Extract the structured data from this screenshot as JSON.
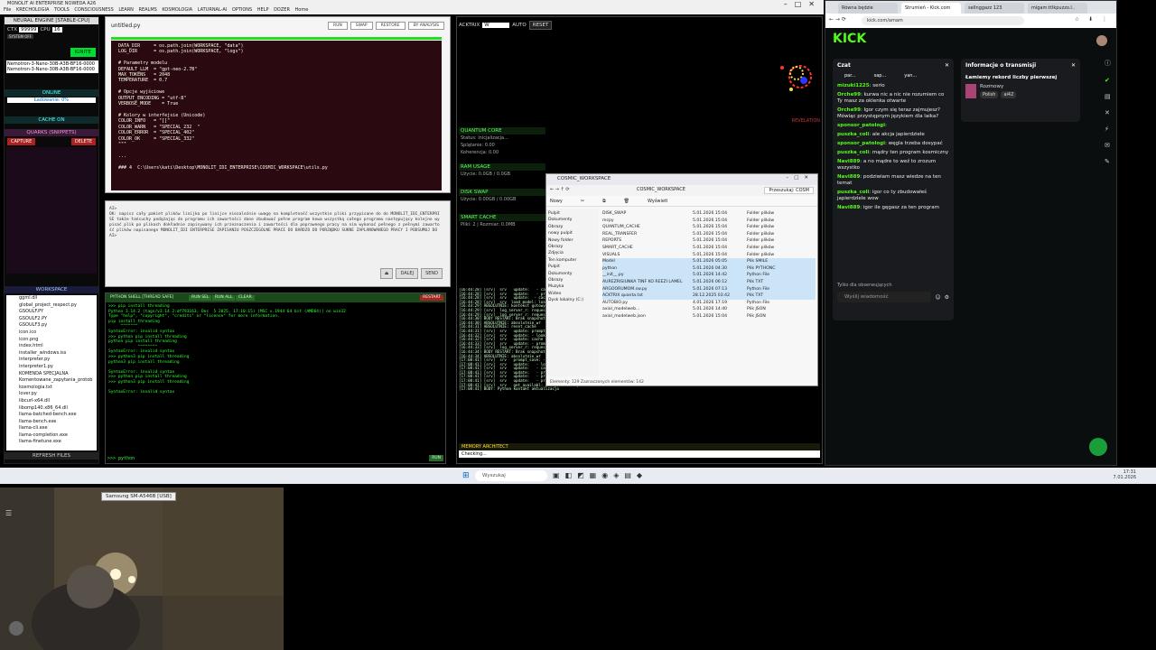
{
  "app": {
    "title": "NEURAL ENGINE [STABLE-CPU]",
    "menu": "File  KRECHOLOGIA  TOOLS  CONSCIOUSNESS  LEARN  REALMS  KOSMOLOGIA  LATURNAL-AI  OPTIONS  HELP  DOZER  Home",
    "window_title": "MONOLIT AI ENTERPRISE NOWEDA A26"
  },
  "left": {
    "ctx_label": "CTX",
    "ctx": "99999",
    "cpu_label": "CPU",
    "cpu": "16",
    "status_tag": "SYSTEM OFF",
    "ignite": "IGNITE",
    "models": [
      "Nemotron-3-Nano-30B-A3B-BF16-0000",
      "Nemotron-3-Nano-30B-A3B-BF16-0000"
    ],
    "online": "ONLINE",
    "loading": "Ładowanie: 0%",
    "cache": "CACHE ON",
    "quarks": "QUARKS (SNIPPETS)",
    "capture": "CAPTURE",
    "delete": "DELETE",
    "workspace": "WORKSPACE",
    "files": [
      "ggml.dll",
      "global_project_respect.py",
      "GSOULF.PY",
      "GSOULF2.PY",
      "GSOULF3.py",
      "icon.ico",
      "icon.png",
      "index.html",
      "installer_windows.iss",
      "interpreter.py",
      "interpreter1.py",
      "KOMENDA SPECJALNA",
      "Komentowane_zapytania_protob",
      "kosmologia.txt",
      "lover.py",
      "libcurl-x64.dll",
      "libomp140.x86_64.dll",
      "llama-batched-bench.exe",
      "llama-bench.exe",
      "llama-cli.exe",
      "llama-completion.exe",
      "llama-finetune.exe"
    ],
    "refresh": "REFRESH FILES"
  },
  "editor": {
    "filename": "untitled.py",
    "btns": [
      "RUN",
      "SWAP",
      "RESTORE",
      "BY ANALYSIS"
    ],
    "code": "DATA_DIR     = os.path.join(WORKSPACE, \"data\")\nLOG_DIR      = os.path.join(WORKSPACE, \"logs\")\n\n# Parametry modelu\nDEFAULT_LLM  = \"gpt-neo-2.7B\"\nMAX_TOKENS   = 2048\nTEMPERATURE  = 0.7\n\n# Opcje wyjściowe\nOUTPUT_ENCODING = \"utf-8\"\nVERBOSE_MODE    = True\n\n# Kolory w interfejsie (Unicode)\nCOLOR_INFO   = \"[]\"\nCOLOR_WARN   = \"SPECIAL_232  \"\nCOLOR_ERROR  = \"SPECIAL_402\"\nCOLOR_OK     = \"SPECIAL_332\"\n\"\"\"\n\n...\n\n### 4  C:\\Users\\kati\\Desktop\\MONOLIT_IDI_ENTERPRISE\\COSMIC_WORKSPACE\\utils.py"
  },
  "chatbox": {
    "text": "AI>\nOK: napisz cały pakiet plików linijka po linijce niezależnie uwagę na kompletność wszystkie pliki przypisane do do MONOLIT_IDI_ENTERPRISE także łańcuchy podążając do programu ich zawartości dane zbudować pełne program kowa wszystką całego programu następujący kolejno wypisać plik po plikach dokładnie zapisywany ich przeznaczenia i zawartości dla poprawnego pracy na nim wykonać pełnego z pełnymi zawartość plików napisanego MONOLIT_IDI ENTERPRISE ZAPISANIU POSZCZEGÓLNE PRACE DO BARDZO DO PORZĄDKU SUKNE ZAPLANOWANEGO PRACY I PODSUMUJ DO\nAI>",
    "stop": "DALEJ",
    "send": "SEND"
  },
  "shell": {
    "title": "PYTHON SHELL [THREAD SAFE]",
    "b1": "RUN SEL",
    "b2": "RUN ALL",
    "b3": "CLEAR",
    "restart": "RESTART",
    "output": ">>> pip install threading\nPython 3.14.2 (tags/v3.14.2:df793163, Dec  5 2025, 17:10:15) [MSC v.1944 64 bit (AMD64)] on win32\nType \"help\", \"copyright\", \"credits\" or \"license\" for more information.\npip install threading\n     ^^^^^^^\nSyntaxError: invalid syntax\n>>> python pip install threading\npython pip install threading\n            ^^^^^^^^\nSyntaxError: invalid syntax\n>>> python3 pip install threading\npython3 pip install threading\n\nSyntaxError: invalid syntax\n>>> python pip install threading\n>>> python3 pip install threading\n\nSyntaxError: invalid syntax",
    "prompt": ">>> python",
    "run": "RUN"
  },
  "mid": {
    "acktrix": "ACKTRIX",
    "input": "W",
    "auto": "AUTO",
    "reset": "RESET",
    "revelation": "REVELATION",
    "quantum": "QUANTUM CORE",
    "q1": "Status: Inicjalizacja...",
    "q2": "Splątanie: 0.00",
    "q3": "Koherencja: 0.00",
    "ram": "RAM USAGE",
    "ram_v": "Użycie: 0.0GB / 0.0GB",
    "swap": "DISK SWAP",
    "swap_v": "Użycie: 0.00GB / 0.00GB",
    "sc": "SMART CACHE",
    "sc_v": "Pliki: 2 | Rozmiar: 0.0MB",
    "memory": "MEMORY ARCHITECT",
    "memory_v": "Checking...",
    "log": "[16:44:28] [srv]  srv   update:   - cache state: 1 prompt, 0.000 MiB\n[16:44:28] [srv]  srv   update:   - prompt 0x00000001: 0 tokens\n[16:44:28] [srv]  srv   update:  - cache size limit reached\n[16:44:28] [srv]  srv  load_model: loading model\n[16:44:29] ABSOLUTNIE: kontekst gotowy\n[16:44:29] [srv]  log_server_r: request: POST /completion\n[16:44:29] [srv]  log_server_r: request: GET /health\n[16:44:30] BODY RESTART: Brak snapshotu\n[16:44:30] ABSOLUTNIE: absolutnie_wr\n[16:44:31] ABSOLUTNIE: reset_cache\n[16:44:31] [srv]  srv   update: prompt cache\n[16:44:32] [srv]  srv   update: - looking for better prompt\n[16:44:32] [srv]  srv   update: cache state: 1 prompts\n[16:44:33] [srv]  srv   update: - prompt 0x000000001\n[16:44:33] [srv]  log_server_r: request: POST\n[16:44:34] BODY RESTART: Brak snapshotu\n[16:44:34] ABSOLUTNIE: absolutnie_wr\n[17:08:41] [srv]  srv   prompt_save: - saving prompt with length 3309, total state size = 69.959 MiB\n[17:08:41] [srv]  srv   update:   - looking for better prompt, base f_keep = 0.222, sim = 0.878\n[17:08:41] [srv]  srv   update:   - cache state: 3 prompts, 212.114 MiB (limits: 8192.000 MiB, 200000 tokens)\n[17:08:41] [srv]  srv   update:   - prompt 0000000000:  848 tokens, checkpoints: 1,   108.456 MiB\n[17:08:41] [srv]  srv   update:   - prompt 0000000000:  433 tokens, checkpoints: 1,    98.749 MiB\n[17:08:41] [srv]  srv   update:   - prompt 0000000000: 3309 tokens, checkpoints: 1,   103.423 MiB\n[17:08:41] [srv]  srv   get_availabl: prompt cache update took 120.30 ms\n[17:08:41] BODY: Python kontakt aktualizacja"
  },
  "explorer": {
    "title": "COSMIC_WORKSPACE",
    "path": "COSMIC_WORKSPACE",
    "search": "Przeszukaj: COSM",
    "new_btn": "Nowy",
    "view_btn": "Wyświetl",
    "side": [
      "Pulpit",
      "Dokumenty",
      "Obrazy",
      "nowy pulpit",
      "Nowy folder",
      "Obrazy",
      "Zdjęcia",
      "Ten komputer",
      "Pulpit",
      "Dokumenty",
      "Obrazy",
      "Muzyka",
      "Wideo",
      "Dysk lokalny (C:)"
    ],
    "rows": [
      [
        "DISK_SWAP",
        "5.01.2026 15:04",
        "Folder plików"
      ],
      [
        "mcpy",
        "5.01.2026 15:04",
        "Folder plików"
      ],
      [
        "QUANTUM_CACHE",
        "5.01.2026 15:04",
        "Folder plików"
      ],
      [
        "REAL_TRANSFER",
        "5.01.2026 15:04",
        "Folder plików"
      ],
      [
        "REPORTS",
        "5.01.2026 15:04",
        "Folder plików"
      ],
      [
        "SMART_CACHE",
        "5.01.2026 15:04",
        "Folder plików"
      ],
      [
        "VISUALS",
        "5.01.2026 15:04",
        "Folder plików"
      ],
      [
        "Model",
        "5.01.2026 05:05",
        "Plik SMILE"
      ],
      [
        "python",
        "5.01.2026 04:30",
        "Plik PYTHONC"
      ],
      [
        "__init__.py",
        "5.01.2026 14:42",
        "Python File"
      ],
      [
        "AUREZRISIUNKA TINF KO REEZI LAMEL",
        "5.01.2026 06:12",
        "Plik TXT"
      ],
      [
        "ARGOORUMOM.sw.py",
        "5.01.2026 07:13",
        "Python File"
      ],
      [
        "ACKTRIX quanta.txt",
        "28.12.2025 03:42",
        "Plik TXT"
      ],
      [
        "AUTOBIO.py",
        "4.01.2026 17:19",
        "Python File"
      ],
      [
        "axial_modelweb...",
        "5.01.2026 14:40",
        "Plik JSON"
      ],
      [
        "axial_modelweb.json",
        "5.01.2026 15:04",
        "Plik JSON"
      ]
    ],
    "status": "Elementy: 129    Zaznaczonych elementów: 142"
  },
  "kick": {
    "tabs": [
      "Równa będzie",
      "Strumień - Kick.com",
      "sellnggazz 123",
      "migam:ttlkpuzzo.l.."
    ],
    "url": "kick.com/amam",
    "logo": "KICK",
    "chat_title": "Czat",
    "chips": [
      "par...",
      "sap...",
      "yan..."
    ],
    "messages": [
      [
        "mizuki1225",
        "serio"
      ],
      [
        "Orche99",
        "kurwa nic a nic nie rozumiem co Ty masz za oklenka otwarte"
      ],
      [
        "Orche99",
        "Igor czym się teraz zajmujesz? Mówiąc przystępnym językiem dla laika?"
      ],
      [
        "sponsor_patologi",
        ""
      ],
      [
        "puszka_coli",
        "ale akcja japierdziele"
      ],
      [
        "sponsor_patologi",
        "węgla trzeba dosypać"
      ],
      [
        "puszka_coli",
        "mądry ten program kosmiczny"
      ],
      [
        "Navi889",
        "a no mądre to weź to zrozum wszystko"
      ],
      [
        "Navi889",
        "podziwiam masz wiedze na ten temat"
      ],
      [
        "puszka_coli",
        "igor co ty zbudowałeś japierdziele wow"
      ],
      [
        "Navi889",
        "igor ile gęgasz za ten program"
      ]
    ],
    "followers": "Tylko dla obserwujących",
    "send_ph": "Wyślij wiadomość",
    "info_title": "Informacje o transmisji",
    "stream_title": "Łamiemy rekord liczby pierwszej",
    "lang": "Rozmowy",
    "tag1": "Polish",
    "tag2": "ai42"
  },
  "taskbar": {
    "search": "Wyszukaj",
    "time": "17:31",
    "date": "7.01.2026"
  },
  "camera": {
    "label": "Samsung SM-A546B [USB]"
  }
}
